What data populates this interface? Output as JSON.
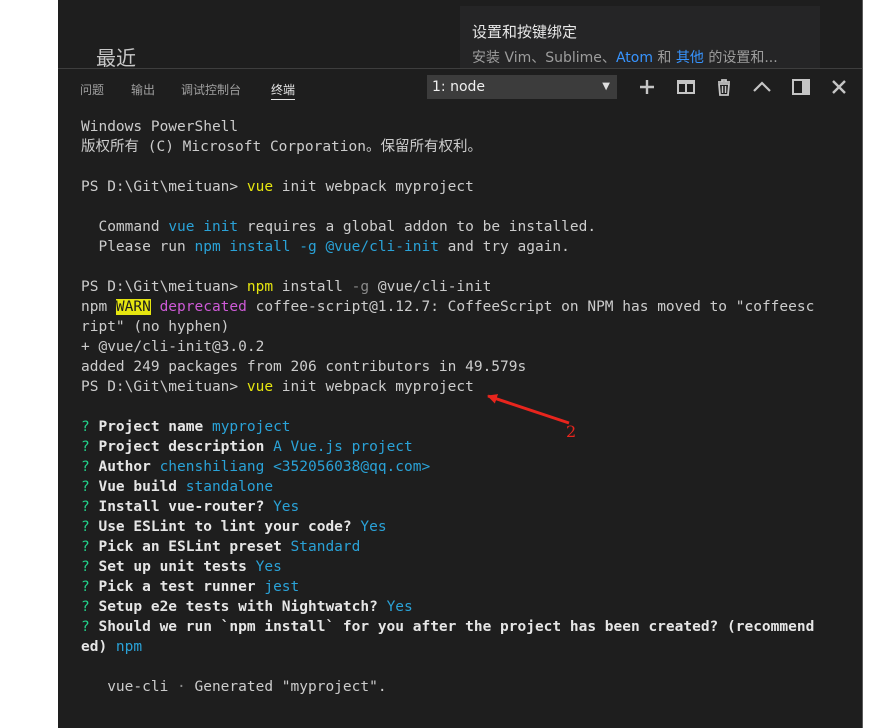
{
  "welcome": {
    "heading": "最近",
    "card_title": "设置和按键绑定",
    "card_desc_prefix": "安装 Vim、Sublime、",
    "card_desc_link1": "Atom",
    "card_desc_mid": " 和 ",
    "card_desc_link2": "其他",
    "card_desc_suffix": " 的设置和..."
  },
  "panel": {
    "tabs": [
      {
        "label": "问题"
      },
      {
        "label": "输出"
      },
      {
        "label": "调试控制台"
      },
      {
        "label": "终端",
        "active": true
      }
    ],
    "terminal_select": "1: node",
    "actions": [
      "add-icon",
      "split-icon",
      "trash-icon",
      "chevron-up-icon",
      "maximize-panel-icon",
      "close-icon"
    ]
  },
  "terminal": {
    "lines": [
      [
        [
          "Windows PowerShell",
          "n"
        ]
      ],
      [
        [
          "版权所有 (C) Microsoft Corporation。保留所有权利。",
          "n"
        ]
      ],
      [],
      [
        [
          "PS D:\\Git\\meituan> ",
          "n"
        ],
        [
          "vue",
          "y"
        ],
        [
          " init webpack myproject",
          "n"
        ]
      ],
      [],
      [
        [
          "  Command ",
          "n"
        ],
        [
          "vue init",
          "b"
        ],
        [
          " requires a global addon to be installed.",
          "n"
        ]
      ],
      [
        [
          "  Please run ",
          "n"
        ],
        [
          "npm install -g @vue/cli-init",
          "b"
        ],
        [
          " and try again.",
          "n"
        ]
      ],
      [],
      [
        [
          "PS D:\\Git\\meituan> ",
          "n"
        ],
        [
          "npm",
          "y"
        ],
        [
          " install ",
          "n"
        ],
        [
          "-g",
          "gr"
        ],
        [
          " @vue/cli-init",
          "n"
        ]
      ],
      [
        [
          "npm ",
          "n"
        ],
        [
          "WARN",
          "w"
        ],
        [
          " ",
          "n"
        ],
        [
          "deprecated",
          "m"
        ],
        [
          " coffee-script@1.12.7: CoffeeScript on NPM has moved to \"coffeesc",
          "n"
        ]
      ],
      [
        [
          "ript\" (no hyphen)",
          "n"
        ]
      ],
      [
        [
          "+ @vue/cli-init@3.0.2",
          "n"
        ]
      ],
      [
        [
          "added 249 packages from 206 contributors in 49.579s",
          "n"
        ]
      ],
      [
        [
          "PS D:\\Git\\meituan> ",
          "n"
        ],
        [
          "vue",
          "y"
        ],
        [
          " init webpack myproject",
          "n"
        ]
      ],
      [],
      [
        [
          "? ",
          "g"
        ],
        [
          "Project name ",
          "k"
        ],
        [
          "myproject",
          "b"
        ]
      ],
      [
        [
          "? ",
          "g"
        ],
        [
          "Project description ",
          "k"
        ],
        [
          "A Vue.js project",
          "b"
        ]
      ],
      [
        [
          "? ",
          "g"
        ],
        [
          "Author ",
          "k"
        ],
        [
          "chenshiliang <352056038@qq.com>",
          "b"
        ]
      ],
      [
        [
          "? ",
          "g"
        ],
        [
          "Vue build ",
          "k"
        ],
        [
          "standalone",
          "b"
        ]
      ],
      [
        [
          "? ",
          "g"
        ],
        [
          "Install vue-router? ",
          "k"
        ],
        [
          "Yes",
          "b"
        ]
      ],
      [
        [
          "? ",
          "g"
        ],
        [
          "Use ESLint to lint your code? ",
          "k"
        ],
        [
          "Yes",
          "b"
        ]
      ],
      [
        [
          "? ",
          "g"
        ],
        [
          "Pick an ESLint preset ",
          "k"
        ],
        [
          "Standard",
          "b"
        ]
      ],
      [
        [
          "? ",
          "g"
        ],
        [
          "Set up unit tests ",
          "k"
        ],
        [
          "Yes",
          "b"
        ]
      ],
      [
        [
          "? ",
          "g"
        ],
        [
          "Pick a test runner ",
          "k"
        ],
        [
          "jest",
          "b"
        ]
      ],
      [
        [
          "? ",
          "g"
        ],
        [
          "Setup e2e tests with Nightwatch? ",
          "k"
        ],
        [
          "Yes",
          "b"
        ]
      ],
      [
        [
          "? ",
          "g"
        ],
        [
          "Should we run `npm install` for you after the project has been created? (recommend",
          "k"
        ]
      ],
      [
        [
          "ed) ",
          "k"
        ],
        [
          "npm",
          "b"
        ]
      ],
      [],
      [
        [
          "   vue-cli ",
          "n"
        ],
        [
          "·",
          "gr"
        ],
        [
          " Generated \"myproject\".",
          "n"
        ]
      ]
    ]
  },
  "annotation": {
    "label": "2",
    "color": "#e8251d"
  }
}
